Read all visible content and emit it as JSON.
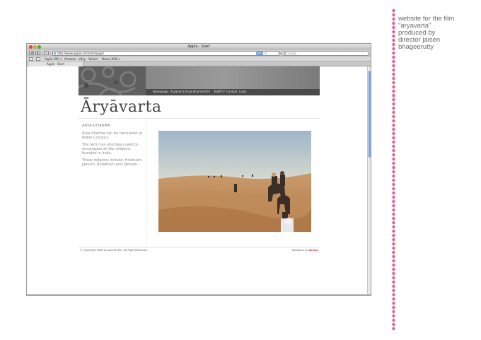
{
  "window": {
    "title": "Apple - Start",
    "address": "http://www.apple.com/startpage/",
    "rss_label": "RSS",
    "reload_glyph": "C",
    "search_placeholder": "Google",
    "bookmarks": [
      "Apple (99) ▾",
      "Amazon",
      "eBay",
      "Yahoo!",
      "News (400) ▾"
    ],
    "tab_label": "Apple - Start",
    "back_glyph": "◀",
    "forward_glyph": "▶",
    "add_glyph": "+"
  },
  "site": {
    "logo": "Āryāvarta",
    "nav": [
      "Homepage",
      "Aryāvarta",
      "Arya-dharma",
      "Film",
      "Staff/TV",
      "Contact",
      "Links"
    ],
    "sidebar": {
      "heading": "ARYA-DHARMA",
      "p1": "Ārya-dharma can be translated as Noble Conduct.",
      "p2": "The term has also been used to encompass all the religions founded in India.",
      "p3": "These religions include: Hinduism, Jainism, Buddhism and Sikhism."
    },
    "footer": {
      "copyright": "© Copyright 2008 Aryavarta-film. All Right Reserved.",
      "designed_by": "Designed by",
      "designer": "design"
    }
  },
  "annotation": {
    "lines": [
      "website for the film",
      "\"aryavarta\"",
      "produced by",
      "director jaisen",
      "bhageerutty"
    ],
    "accent_color": "#e05590"
  }
}
